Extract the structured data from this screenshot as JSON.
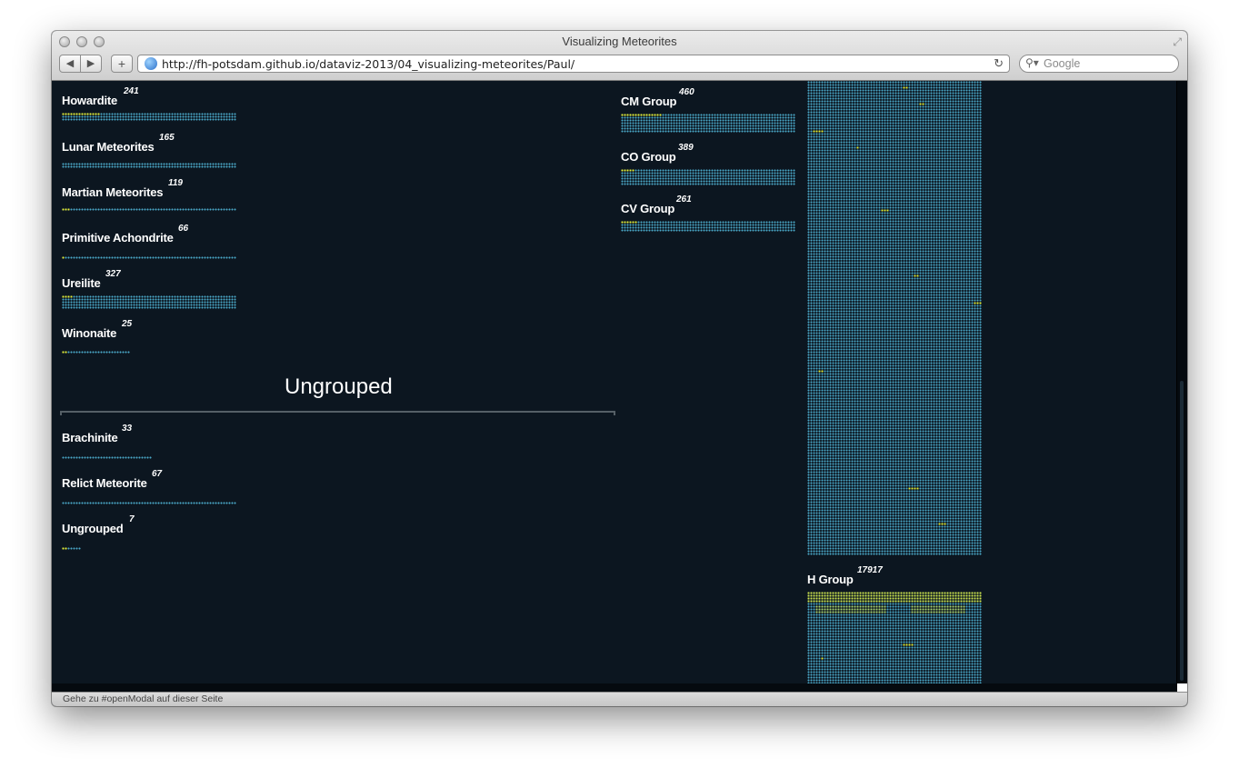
{
  "window": {
    "title": "Visualizing Meteorites"
  },
  "toolbar": {
    "back_label": "◀",
    "forward_label": "▶",
    "add_label": "+",
    "url": "http://fh-potsdam.github.io/dataviz-2013/04_visualizing-meteorites/Paul/",
    "search_placeholder": "Google"
  },
  "status": {
    "text": "Gehe zu #openModal auf dieser Seite"
  },
  "colors": {
    "background": "#0c1620",
    "dot": "#4aa8c8",
    "highlight": "#e5f03a"
  },
  "left_groups": [
    {
      "name": "Howardite",
      "count": "241"
    },
    {
      "name": "Lunar Meteorites",
      "count": "165"
    },
    {
      "name": "Martian Meteorites",
      "count": "119"
    },
    {
      "name": "Primitive Achondrite",
      "count": "66"
    },
    {
      "name": "Ureilite",
      "count": "327"
    },
    {
      "name": "Winonaite",
      "count": "25"
    }
  ],
  "ungrouped_section": {
    "title": "Ungrouped",
    "groups": [
      {
        "name": "Brachinite",
        "count": "33"
      },
      {
        "name": "Relict Meteorite",
        "count": "67"
      },
      {
        "name": "Ungrouped",
        "count": "7"
      }
    ]
  },
  "middle_groups": [
    {
      "name": "CM Group",
      "count": "460"
    },
    {
      "name": "CO Group",
      "count": "389"
    },
    {
      "name": "CV Group",
      "count": "261"
    }
  ],
  "right_groups": [
    {
      "name": "H Group",
      "count": "17917"
    }
  ]
}
